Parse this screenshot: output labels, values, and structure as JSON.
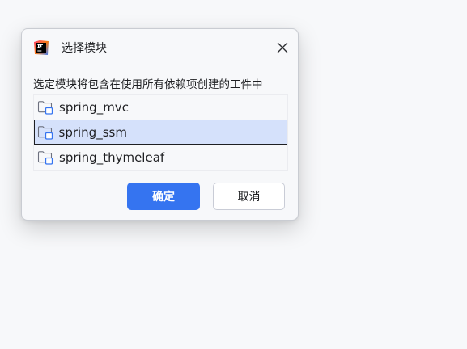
{
  "dialog": {
    "title": "选择模块",
    "app_icon": "intellij-idea-icon",
    "close_icon": "close-icon",
    "instruction": "选定模块将包含在使用所有依赖项创建的工件中",
    "modules": [
      {
        "label": "spring_mvc",
        "icon": "module-folder-icon",
        "selected": false
      },
      {
        "label": "spring_ssm",
        "icon": "module-folder-icon",
        "selected": true
      },
      {
        "label": "spring_thymeleaf",
        "icon": "module-folder-icon",
        "selected": false
      }
    ],
    "ok_label": "确定",
    "cancel_label": "取消"
  },
  "colors": {
    "accent": "#3574f0",
    "selection_bg": "#d5e1fb",
    "background": "#f7f8fa"
  }
}
